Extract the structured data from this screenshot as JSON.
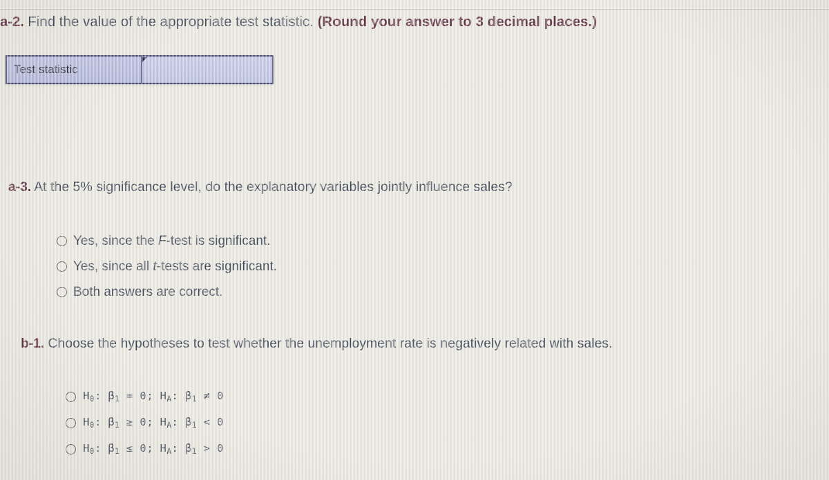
{
  "questions": {
    "a2": {
      "label": "a-2.",
      "prompt": " Find the value of the appropriate test statistic. ",
      "rounding_note": "(Round your answer to 3 decimal places.)",
      "answer_table": {
        "row_label": "Test statistic",
        "input_value": "",
        "input_placeholder": ""
      }
    },
    "a3": {
      "label": "a-3.",
      "prompt": " At the 5% significance level, do the explanatory variables jointly influence sales?",
      "options": [
        {
          "pre": "Yes, since the ",
          "italic": "F",
          "post": "-test is significant."
        },
        {
          "pre": "Yes, since all ",
          "italic": "t",
          "post": "-tests are significant."
        },
        {
          "pre": "Both answers are correct.",
          "italic": "",
          "post": ""
        }
      ]
    },
    "b1": {
      "label": "b-1.",
      "prompt": " Choose the hypotheses to test whether the unemployment rate is negatively related with sales.",
      "options": [
        {
          "null_symbol": "H",
          "null_sub": "0",
          "null_statement": "β",
          "null_sub2": "1",
          "null_relation": "=",
          "null_value": "0",
          "alt_symbol": "H",
          "alt_sub": "A",
          "alt_statement": "β",
          "alt_sub2": "1",
          "alt_relation": "≠",
          "alt_value": "0",
          "full_text": "H0: β1 = 0; HA: β1 ≠ 0"
        },
        {
          "null_symbol": "H",
          "null_sub": "0",
          "null_statement": "β",
          "null_sub2": "1",
          "null_relation": "≥",
          "null_value": "0",
          "alt_symbol": "H",
          "alt_sub": "A",
          "alt_statement": "β",
          "alt_sub2": "1",
          "alt_relation": "<",
          "alt_value": "0",
          "full_text": "H0: β1 ≥ 0; HA: β1 < 0"
        },
        {
          "null_symbol": "H",
          "null_sub": "0",
          "null_statement": "β",
          "null_sub2": "1",
          "null_relation": "≤",
          "null_value": "0",
          "alt_symbol": "H",
          "alt_sub": "A",
          "alt_statement": "β",
          "alt_sub2": "1",
          "alt_relation": ">",
          "alt_value": "0",
          "full_text": "H0: β1 ≤ 0; HA: β1 > 0"
        }
      ]
    }
  },
  "colors": {
    "question_label": "#5d2c3f",
    "body_text": "#3a4352",
    "table_border": "#3b3b66",
    "table_fill": "#b7bbdd",
    "input_fill": "#c3c7e6",
    "page_background": "#e8e6dd"
  }
}
